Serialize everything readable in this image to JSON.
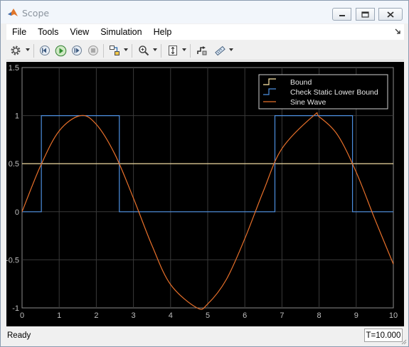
{
  "window": {
    "title": "Scope",
    "minimize_label": "",
    "colors": {
      "titlebar": "#f2f6fb",
      "plot_background": "#000000",
      "grid": "#3a3a3a"
    }
  },
  "menu": {
    "items": [
      "File",
      "Tools",
      "View",
      "Simulation",
      "Help"
    ]
  },
  "toolbar": {
    "icons": [
      "gear-icon",
      "step-back-icon",
      "run-icon",
      "step-forward-icon",
      "stop-icon",
      "highlight-block-icon",
      "zoom-icon",
      "scale-axes-icon",
      "triggers-icon",
      "measurements-icon"
    ]
  },
  "status": {
    "text": "Ready",
    "time": "T=10.000"
  },
  "chart_data": {
    "type": "line",
    "title": "",
    "xlabel": "",
    "ylabel": "",
    "xlim": [
      0,
      10
    ],
    "ylim": [
      -1,
      1.5
    ],
    "xticks": [
      "0",
      "1",
      "2",
      "3",
      "4",
      "5",
      "6",
      "7",
      "8",
      "9",
      "10"
    ],
    "yticks": [
      "-1",
      "-0.5",
      "0",
      "0.5",
      "1",
      "1.5"
    ],
    "grid": true,
    "legend_position": "top-right",
    "series": [
      {
        "name": "Bound",
        "color": "#ffe9a8",
        "style": "stairs",
        "x": [
          0,
          10
        ],
        "y": [
          0.5,
          0.5
        ]
      },
      {
        "name": "Check Static  Lower Bound",
        "color": "#4d8fe0",
        "style": "stairs",
        "x": [
          0,
          0.52,
          2.62,
          6.81,
          8.9,
          10
        ],
        "y": [
          0,
          1,
          0,
          1,
          0,
          0
        ]
      },
      {
        "name": "Sine Wave",
        "color": "#e8702a",
        "style": "line",
        "x": [
          0,
          0.5,
          1,
          1.5708,
          2,
          2.5,
          3,
          3.5,
          4,
          4.7124,
          5,
          5.5,
          6,
          6.5,
          7,
          7.854,
          8,
          8.5,
          9,
          9.5,
          10
        ],
        "y": [
          0,
          0.479,
          0.841,
          1,
          0.909,
          0.598,
          0.141,
          -0.351,
          -0.757,
          -1,
          -0.959,
          -0.706,
          -0.279,
          0.215,
          0.657,
          1,
          0.989,
          0.798,
          0.412,
          -0.075,
          -0.544
        ]
      }
    ]
  }
}
